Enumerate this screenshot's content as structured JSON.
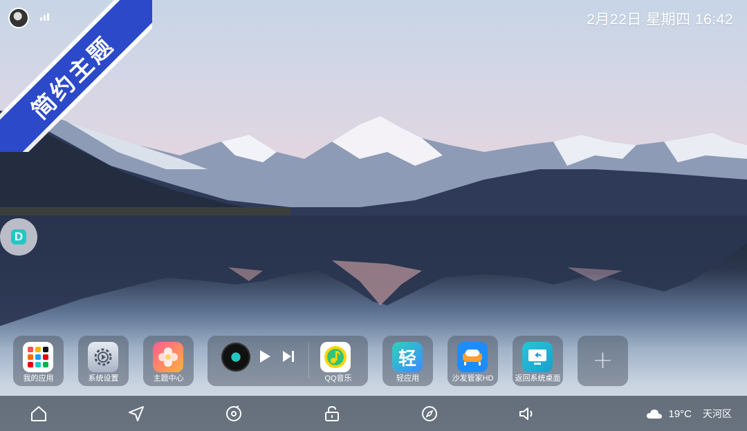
{
  "status_bar": {
    "datetime": "2月22日 星期四 16:42",
    "avatar_icon": "user-avatar"
  },
  "theme_ribbon": {
    "text": "简约主题",
    "color": "#2b49c9"
  },
  "dock": {
    "apps": [
      {
        "label": "我的应用",
        "icon": "app-grid-icon"
      },
      {
        "label": "系统设置",
        "icon": "gear-icon"
      },
      {
        "label": "主题中心",
        "icon": "flower-icon"
      }
    ],
    "music_player": {
      "label": "QQ音乐",
      "icon": "qq-music-icon"
    },
    "apps_right": [
      {
        "label": "轻应用",
        "icon_text": "轻"
      },
      {
        "label": "沙发管家HD",
        "icon": "sofa-icon"
      },
      {
        "label": "返回系统桌面",
        "icon": "return-desktop-icon"
      }
    ],
    "add_label": "+"
  },
  "navbar": {
    "icons": [
      "home-icon",
      "navigation-icon",
      "music-icon",
      "unlock-icon",
      "compass-icon",
      "volume-icon"
    ]
  },
  "weather": {
    "temperature": "19°C",
    "location": "天河区",
    "icon": "cloud-icon"
  },
  "colors": {
    "accent": "#22c7c4",
    "ribbon": "#2b49c9",
    "dock_bg": "rgba(85,95,110,.55)"
  }
}
